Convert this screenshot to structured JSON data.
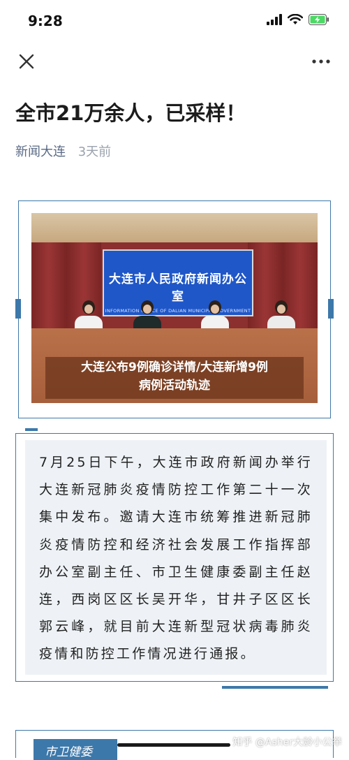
{
  "status_bar": {
    "time": "9:28",
    "icons": [
      "signal-icon",
      "wifi-icon",
      "battery-charging-icon"
    ],
    "battery_color": "#4cd964"
  },
  "nav": {
    "close_icon": "close-icon",
    "more_icon": "more-icon"
  },
  "article": {
    "title": "全市21万余人，已采样！",
    "source": "新闻大连",
    "time_ago": "3天前"
  },
  "image_block": {
    "screen_title": "大连市人民政府新闻办公室",
    "screen_subtitle": "INFORMATION OFFICE OF DALIAN MUNICIPAL GOVERNMENT",
    "caption_line1": "大连公布9例确诊详情/大连新增9例",
    "caption_line2": "病例活动轨迹"
  },
  "body_text": "7月25日下午，大连市政府新闻办举行大连新冠肺炎疫情防控工作第二十一次集中发布。邀请大连市统筹推进新冠肺炎疫情防控和经济社会发展工作指挥部办公室副主任、市卫生健康委副主任赵连，西岗区区长吴开华，甘井子区区长郭云峰，就目前大连新型冠状病毒肺炎疫情和防控工作情况进行通报。",
  "section": {
    "label": "市卫健委"
  },
  "watermark": "知乎 @Asher大龄小公举",
  "colors": {
    "accent": "#3d78aa",
    "source_text": "#5a6b86",
    "muted_text": "#9aa2ad",
    "body_box_bg": "#eef2f6"
  }
}
